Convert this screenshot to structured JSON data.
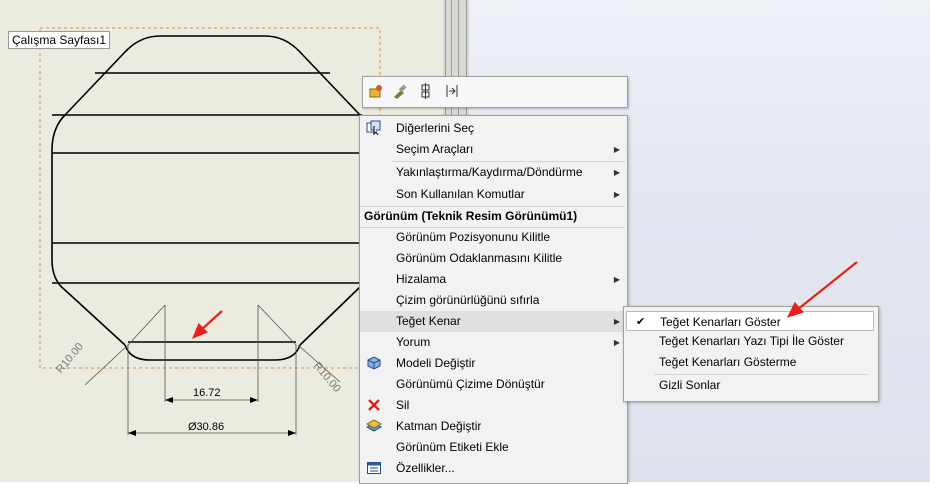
{
  "sheet_label": "Çalışma Sayfası1",
  "dimensions": {
    "radius_left": "R10.00",
    "radius_right": "R10.00",
    "width_inner": "16.72",
    "diameter": "Ø30.86"
  },
  "mini_toolbar": {
    "icons": [
      "smart-dimension-icon",
      "properties-brush-icon",
      "align-icon",
      "layer-icon"
    ]
  },
  "context_menu": {
    "items_top": [
      {
        "label": "Diğerlerini Seç",
        "icon": "select-other-icon",
        "arrow": false
      },
      {
        "label": "Seçim Araçları",
        "arrow": true
      },
      {
        "label": "Yakınlaştırma/Kaydırma/Döndürme",
        "arrow": true
      },
      {
        "label": "Son Kullanılan Komutlar",
        "arrow": true
      }
    ],
    "section_header": "Görünüm (Teknik Resim Görünümü1)",
    "items_view": [
      {
        "label": "Görünüm Pozisyonunu Kilitle",
        "arrow": false
      },
      {
        "label": "Görünüm Odaklanmasını Kilitle",
        "arrow": false
      },
      {
        "label": "Hizalama",
        "arrow": true
      },
      {
        "label": "Çizim görünürlüğünü sıfırla",
        "arrow": false
      },
      {
        "label": "Teğet Kenar",
        "arrow": true,
        "highlighted": true
      },
      {
        "label": "Yorum",
        "arrow": true
      },
      {
        "label": "Modeli Değiştir",
        "icon": "model-icon",
        "arrow": false
      },
      {
        "label": "Görünümü Çizime Dönüştür",
        "arrow": false
      },
      {
        "label": "Sil",
        "icon": "delete-icon",
        "arrow": false
      },
      {
        "label": "Katman Değiştir",
        "icon": "layer-icon",
        "arrow": false
      },
      {
        "label": "Görünüm Etiketi Ekle",
        "arrow": false
      },
      {
        "label": "Özellikler...",
        "icon": "properties-icon",
        "arrow": false
      }
    ]
  },
  "submenu": {
    "items": [
      {
        "label": "Teğet Kenarları Göster",
        "checked": true
      },
      {
        "label": "Teğet Kenarları Yazı Tipi İle Göster",
        "checked": false
      },
      {
        "label": "Teğet Kenarları Gösterme",
        "checked": false
      },
      {
        "label": "Gizli Sonlar",
        "checked": false
      }
    ]
  },
  "colors": {
    "annotation_arrow": "#e8201a",
    "delete_icon": "#e02020",
    "canvas": "#ebebe0"
  }
}
